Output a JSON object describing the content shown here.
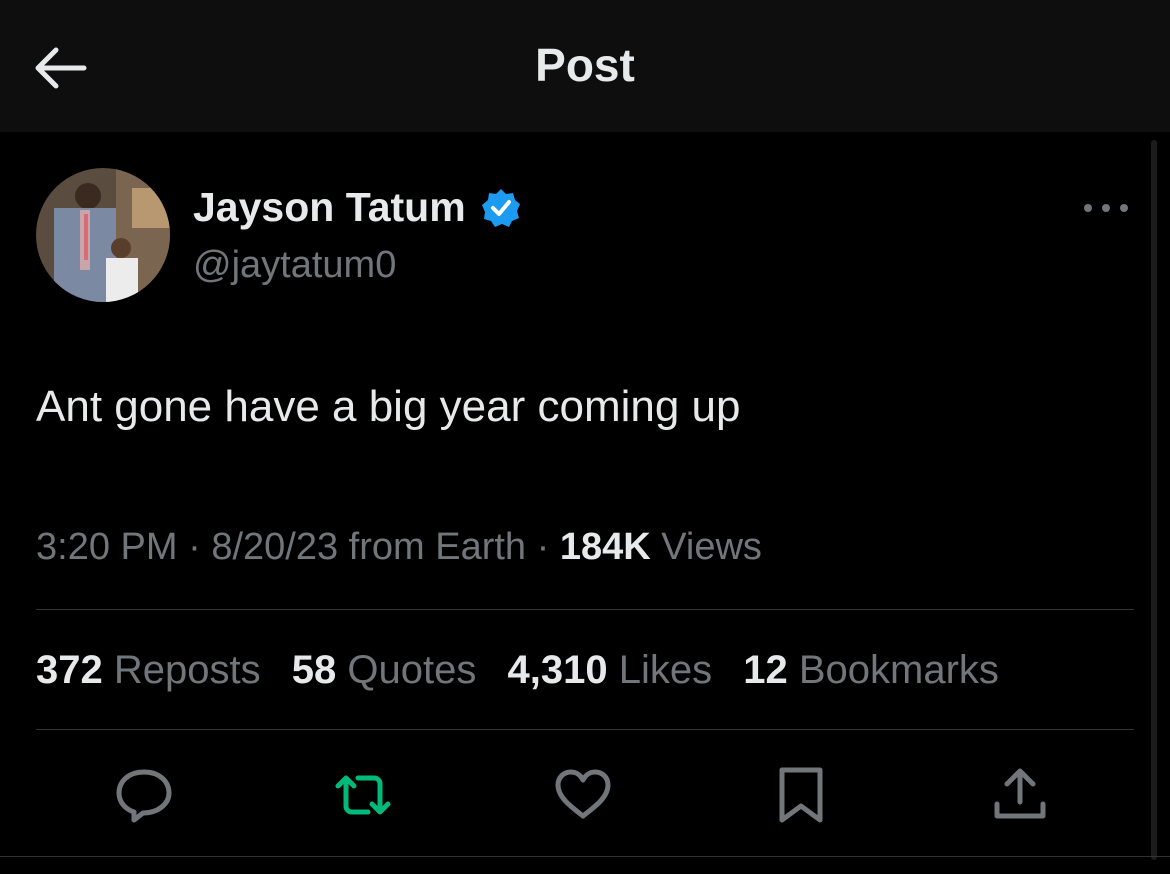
{
  "header": {
    "title": "Post",
    "back_icon": "arrow-left-icon"
  },
  "author": {
    "name": "Jayson Tatum",
    "handle": "@jaytatum0",
    "verified": true,
    "verified_color": "#1d9bf0"
  },
  "tweet": {
    "text": "Ant gone have a big year coming up",
    "time": "3:20 PM",
    "date": "8/20/23",
    "source": "from Earth",
    "separator": "·",
    "views_count": "184K",
    "views_label": "Views"
  },
  "stats": {
    "reposts_count": "372",
    "reposts_label": "Reposts",
    "quotes_count": "58",
    "quotes_label": "Quotes",
    "likes_count": "4,310",
    "likes_label": "Likes",
    "bookmarks_count": "12",
    "bookmarks_label": "Bookmarks"
  },
  "actions": [
    {
      "icon": "reply-icon"
    },
    {
      "icon": "repost-icon",
      "color": "#00ba7c"
    },
    {
      "icon": "heart-icon"
    },
    {
      "icon": "bookmark-icon"
    },
    {
      "icon": "share-icon"
    }
  ],
  "colors": {
    "background": "#000000",
    "header_background": "#0e0e0e",
    "text_primary": "#e7e9ea",
    "text_secondary": "#71767b",
    "divider": "#2f3336"
  }
}
